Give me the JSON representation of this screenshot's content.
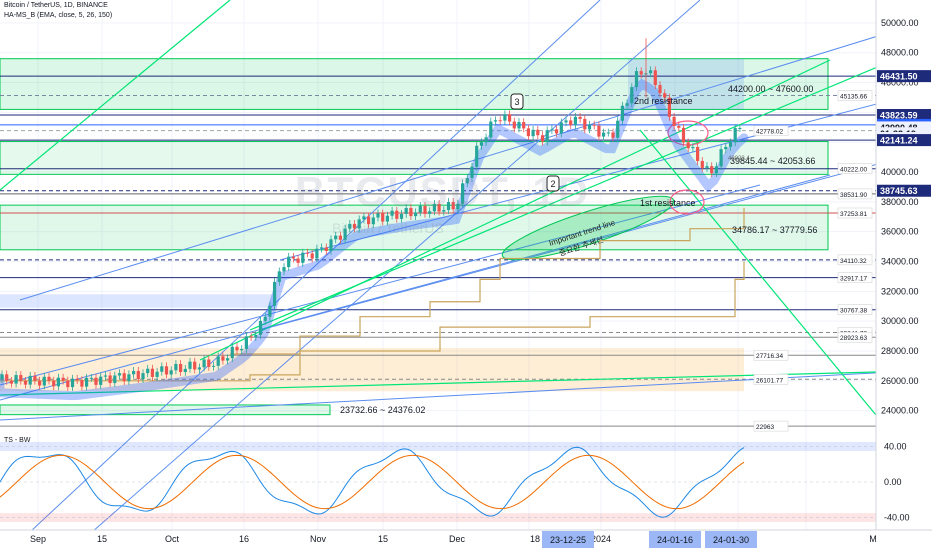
{
  "header": {
    "title": "Bitcoin / TetherUS, 1D, BINANCE",
    "indicator": "HA-MS_B (EMA, close, 5, 26, 150)",
    "watermark": "BTCUSDT, 1D",
    "watermark_sub": "Bitcoin / TetherUS"
  },
  "oscillator": {
    "label": "TS - BW",
    "ticks": [
      "40.00",
      "0.00",
      "-40.00"
    ]
  },
  "price_axis": {
    "ticks": [
      "50000.00",
      "48000.00",
      "46000.00",
      "44000.00",
      "40000.00",
      "38000.00",
      "36000.00",
      "34000.00",
      "32000.00",
      "30000.00",
      "28000.00",
      "26000.00",
      "24000.00"
    ]
  },
  "price_badges": [
    {
      "text": "46431.50",
      "color": "#1e2a7a"
    },
    {
      "text": "43823.59",
      "color": "#1e2a7a"
    },
    {
      "text": "43160.00",
      "color": "#2962ff"
    },
    {
      "text": "42990.48",
      "color": "#eef2ff",
      "text_color": "#131722"
    },
    {
      "text": "01:33:19",
      "color": "#eef2ff",
      "text_color": "#131722"
    },
    {
      "text": "42283.58",
      "color": "#eef2ff",
      "text_color": "#131722"
    },
    {
      "text": "42141.24",
      "color": "#1e2a7a"
    },
    {
      "text": "38745.63",
      "color": "#1e2a7a"
    }
  ],
  "level_labels": [
    "45135.66",
    "42778.02",
    "40222.00",
    "38531.90",
    "37253.81",
    "34110.32",
    "32917.17",
    "30767.38",
    "29241.72",
    "28923.63",
    "27716.34",
    "26101.77",
    "22963"
  ],
  "annotations": {
    "zone_top": "44200.00 ~ 47600.00",
    "resistance2": "2nd resistance",
    "zone_mid": "39845.44 ~ 42053.66",
    "resistance1": "1st resistance",
    "zone_low": "34786.17 ~ 37779.56",
    "zone_bottom": "23732.66 ~ 24376.02",
    "trendline_en": "Important trend line",
    "trendline_kr": "중요한 추세선",
    "marker_2": "2",
    "marker_3": "3",
    "small_label": "42023.4"
  },
  "time_axis": {
    "labels": [
      "Sep",
      "15",
      "Oct",
      "16",
      "Nov",
      "15",
      "Dec",
      "18",
      "2024",
      "15",
      "M"
    ],
    "badges": [
      "23-12-25",
      "24-01-16",
      "24-01-30"
    ]
  },
  "colors": {
    "bull": "#26a69a",
    "bear": "#ef5350",
    "accent": "#2962ff",
    "zone": "#00c853"
  },
  "chart_data": {
    "type": "candlestick",
    "title": "Bitcoin / TetherUS, 1D, BINANCE",
    "ylim": [
      22500,
      51000
    ],
    "grid": true,
    "x": [
      "2023-08-25",
      "2023-09-10",
      "2023-09-25",
      "2023-10-10",
      "2023-10-16",
      "2023-10-20",
      "2023-10-24",
      "2023-11-01",
      "2023-11-09",
      "2023-11-20",
      "2023-11-30",
      "2023-12-05",
      "2023-12-09",
      "2023-12-18",
      "2023-12-25",
      "2024-01-02",
      "2024-01-08",
      "2024-01-11",
      "2024-01-16",
      "2024-01-23",
      "2024-01-27",
      "2024-01-30"
    ],
    "close": [
      26100,
      25900,
      26500,
      27200,
      28500,
      29900,
      33900,
      34700,
      36700,
      37300,
      37700,
      41900,
      43800,
      42300,
      43600,
      42300,
      46900,
      46400,
      42800,
      39800,
      42100,
      43200
    ],
    "horizontal_levels": [
      46431.5,
      45135.66,
      43823.59,
      43160,
      42778.02,
      42141.24,
      40222,
      38745.63,
      38531.9,
      37253.81,
      34110.32,
      32917.17,
      30767.38,
      29241.72,
      28923.63,
      27716.34,
      26101.77,
      22963
    ]
  }
}
